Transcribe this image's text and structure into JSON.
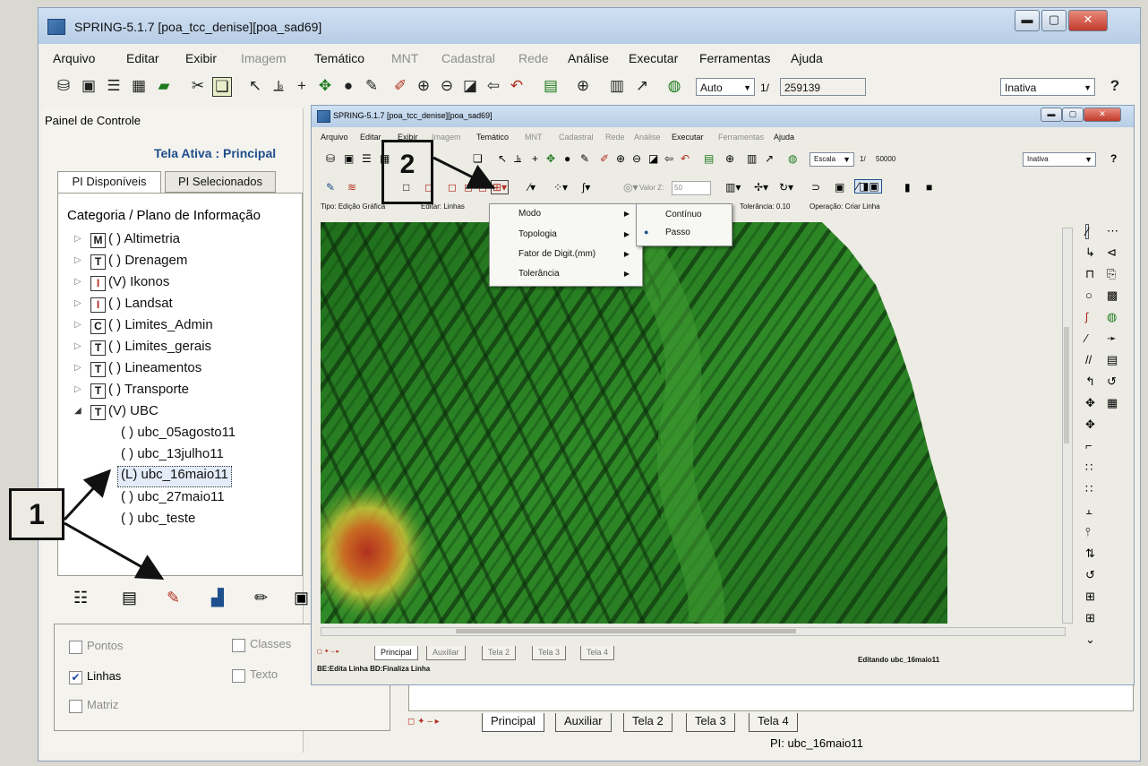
{
  "outer_window": {
    "title": "SPRING-5.1.7 [poa_tcc_denise][poa_sad69]",
    "menu": [
      "Arquivo",
      "Editar",
      "Exibir",
      "Imagem",
      "Temático",
      "MNT",
      "Cadastral",
      "Rede",
      "Análise",
      "Executar",
      "Ferramentas",
      "Ajuda"
    ],
    "toolbar": {
      "mode_value": "Auto",
      "scale_prefix": "1/",
      "scale_value": "259139",
      "state_value": "Inativa"
    },
    "bottom_tabs": [
      "Principal",
      "Auxiliar",
      "Tela 2",
      "Tela 3",
      "Tela 4"
    ],
    "status_text": "PI: ubc_16maio11"
  },
  "panel": {
    "title": "Painel de Controle",
    "active_screen": "Tela Ativa : Principal",
    "tabs": [
      "PI Disponíveis",
      "PI Selecionados"
    ],
    "tree_header": "Categoria / Plano de Informação",
    "categories": [
      {
        "box": "M",
        "label": "( ) Altimetria"
      },
      {
        "box": "T",
        "label": "( ) Drenagem"
      },
      {
        "box": "I",
        "label": "(V) Ikonos"
      },
      {
        "box": "I",
        "label": "( ) Landsat"
      },
      {
        "box": "C",
        "label": "( ) Limites_Admin"
      },
      {
        "box": "T",
        "label": "( ) Limites_gerais"
      },
      {
        "box": "T",
        "label": "( ) Lineamentos"
      },
      {
        "box": "T",
        "label": "( ) Transporte"
      },
      {
        "box": "T",
        "label": "(V) UBC"
      }
    ],
    "ubc_children": [
      "( ) ubc_05agosto11",
      "( ) ubc_13julho11",
      "(L) ubc_16maio11",
      "( ) ubc_27maio11",
      "( ) ubc_teste"
    ],
    "checkboxes": {
      "pontos": "Pontos",
      "linhas": "Linhas",
      "matriz": "Matriz",
      "classes": "Classes",
      "texto": "Texto"
    }
  },
  "inner_window": {
    "title": "SPRING-5.1.7 [poa_tcc_denise][poa_sad69]",
    "menu": [
      "Arquivo",
      "Editar",
      "Exibir",
      "Imagem",
      "Temático",
      "MNT",
      "Cadastral",
      "Rede",
      "Análise",
      "Executar",
      "Ferramentas",
      "Ajuda"
    ],
    "toolbar": {
      "scale_mode": "Escala",
      "scale_prefix": "1/",
      "scale_value": "50000",
      "state_value": "Inativa",
      "value_label": "Valor Z:",
      "value": "50"
    },
    "edit_bar": {
      "tipo": "Tipo: Edição Gráfica",
      "editar": "Editar: Linhas",
      "tolerancia": "Tolerância: 0.10",
      "operacao": "Operação: Criar Linha"
    },
    "context_menu": [
      "Modo",
      "Topologia",
      "Fator de Digit.(mm)",
      "Tolerância"
    ],
    "submenu": [
      "Contínuo",
      "Passo"
    ],
    "bottom_tabs": [
      "Principal",
      "Auxiliar",
      "Tela 2",
      "Tela 3",
      "Tela 4"
    ],
    "status_left": "BE:Edita Linha  BD:Finaliza Linha",
    "status_right": "Editando ubc_16maio11"
  },
  "annotations": {
    "one": "1",
    "two": "2"
  },
  "colors": {
    "title_bar": "#c4d7ee",
    "close_button": "#c0392b",
    "map_green": "#2e8a26",
    "map_red": "#b2301f",
    "map_yellow": "#d7c93b"
  }
}
